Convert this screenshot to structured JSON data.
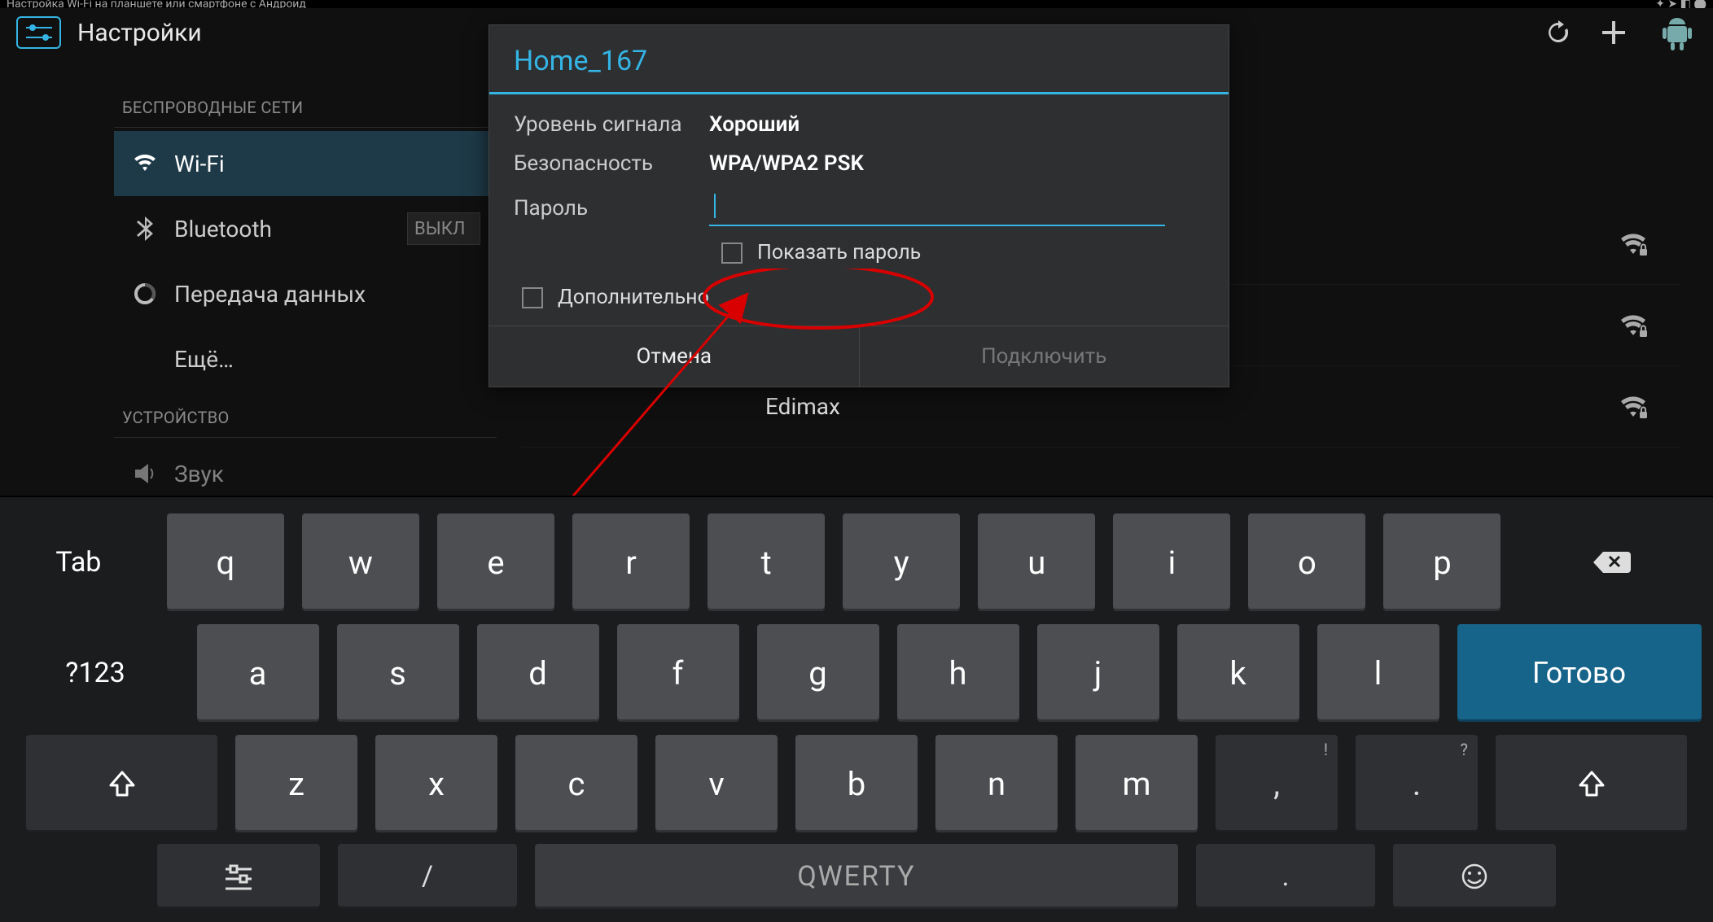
{
  "topbar": {
    "title": "Настройка Wi-Fi на планшете или смартфоне с Андроид"
  },
  "header": {
    "title": "Настройки"
  },
  "sidebar": {
    "section_wireless": "БЕСПРОВОДНЫЕ СЕТИ",
    "wifi": "Wi-Fi",
    "bluetooth": "Bluetooth",
    "bt_toggle": "ВЫКЛ",
    "data": "Передача данных",
    "more": "Ещё…",
    "section_device": "УСТРОЙСТВО",
    "sound": "Звук"
  },
  "wifi_bg": {
    "row4": "Edimax"
  },
  "dialog": {
    "title": "Home_167",
    "signal_label": "Уровень сигнала",
    "signal_value": "Хороший",
    "security_label": "Безопасность",
    "security_value": "WPA/WPA2 PSK",
    "password_label": "Пароль",
    "password_value": "",
    "show_pwd": "Показать пароль",
    "advanced": "Дополнительно",
    "cancel": "Отмена",
    "connect": "Подключить"
  },
  "keyboard": {
    "tab": "Tab",
    "sym": "?123",
    "enter": "Готово",
    "space": "QWERTY",
    "row1": [
      "q",
      "w",
      "e",
      "r",
      "t",
      "y",
      "u",
      "i",
      "o",
      "p"
    ],
    "row2": [
      "a",
      "s",
      "d",
      "f",
      "g",
      "h",
      "j",
      "k",
      "l"
    ],
    "row3": [
      "z",
      "x",
      "c",
      "v",
      "b",
      "n",
      "m",
      ",",
      "."
    ],
    "row3_sup": [
      null,
      null,
      null,
      null,
      null,
      null,
      null,
      "!",
      "?"
    ],
    "row5": [
      "/",
      "."
    ]
  }
}
